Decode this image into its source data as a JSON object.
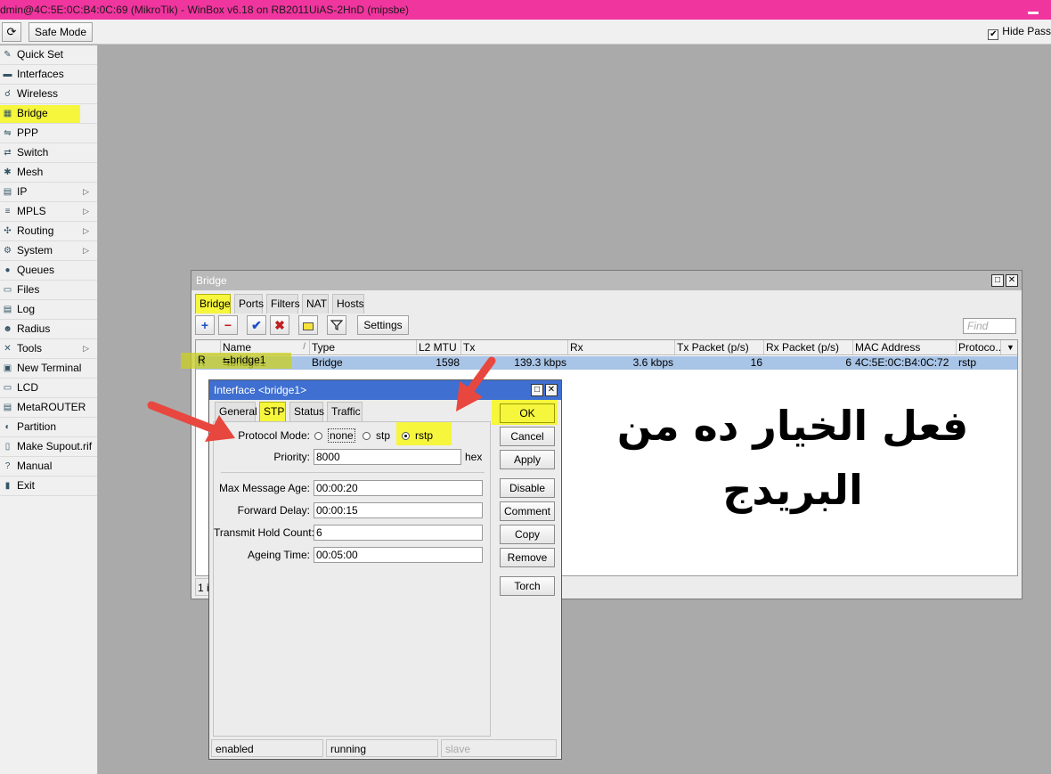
{
  "title_bar": {
    "text": "dmin@4C:5E:0C:B4:0C:69 (MikroTik) - WinBox v6.18 on RB2011UiAS-2HnD (mipsbe)"
  },
  "toolbar": {
    "refresh_icon": "refresh-icon",
    "safe_mode": "Safe Mode",
    "hide_pass": "Hide Pass",
    "hide_pass_checked": true
  },
  "sidebar": {
    "items": [
      {
        "label": "Quick Set",
        "icon": "quick-set-icon",
        "submenu": false
      },
      {
        "label": "Interfaces",
        "icon": "interfaces-icon",
        "submenu": false
      },
      {
        "label": "Wireless",
        "icon": "wireless-icon",
        "submenu": false
      },
      {
        "label": "Bridge",
        "icon": "bridge-icon",
        "submenu": false,
        "highlighted": true
      },
      {
        "label": "PPP",
        "icon": "ppp-icon",
        "submenu": false
      },
      {
        "label": "Switch",
        "icon": "switch-icon",
        "submenu": false
      },
      {
        "label": "Mesh",
        "icon": "mesh-icon",
        "submenu": false
      },
      {
        "label": "IP",
        "icon": "ip-icon",
        "submenu": true
      },
      {
        "label": "MPLS",
        "icon": "mpls-icon",
        "submenu": true
      },
      {
        "label": "Routing",
        "icon": "routing-icon",
        "submenu": true
      },
      {
        "label": "System",
        "icon": "gear-icon",
        "submenu": true
      },
      {
        "label": "Queues",
        "icon": "queues-icon",
        "submenu": false
      },
      {
        "label": "Files",
        "icon": "folder-icon",
        "submenu": false
      },
      {
        "label": "Log",
        "icon": "log-icon",
        "submenu": false
      },
      {
        "label": "Radius",
        "icon": "radius-icon",
        "submenu": false
      },
      {
        "label": "Tools",
        "icon": "tools-icon",
        "submenu": true
      },
      {
        "label": "New Terminal",
        "icon": "terminal-icon",
        "submenu": false
      },
      {
        "label": "LCD",
        "icon": "lcd-icon",
        "submenu": false
      },
      {
        "label": "MetaROUTER",
        "icon": "metarouter-icon",
        "submenu": false
      },
      {
        "label": "Partition",
        "icon": "partition-icon",
        "submenu": false
      },
      {
        "label": "Make Supout.rif",
        "icon": "supout-icon",
        "submenu": false
      },
      {
        "label": "Manual",
        "icon": "manual-icon",
        "submenu": false
      },
      {
        "label": "Exit",
        "icon": "exit-icon",
        "submenu": false
      }
    ]
  },
  "bridge_window": {
    "title": "Bridge",
    "tabs": [
      "Bridge",
      "Ports",
      "Filters",
      "NAT",
      "Hosts"
    ],
    "active_tab": "Bridge",
    "settings_label": "Settings",
    "find_placeholder": "Find",
    "columns": [
      "",
      "Name",
      "Type",
      "L2 MTU",
      "Tx",
      "Rx",
      "Tx Packet (p/s)",
      "Rx Packet (p/s)",
      "MAC Address",
      "Protoco..."
    ],
    "rows": [
      {
        "flag": "R",
        "name": "bridge1",
        "type": "Bridge",
        "l2mtu": "1598",
        "tx": "139.3 kbps",
        "rx": "3.6 kbps",
        "tx_pps": "16",
        "rx_pps": "6",
        "mac": "4C:5E:0C:B4:0C:72",
        "protocol": "rstp"
      }
    ],
    "status": "1 it"
  },
  "interface_dialog": {
    "title": "Interface <bridge1>",
    "tabs": [
      "General",
      "STP",
      "Status",
      "Traffic"
    ],
    "active_tab": "STP",
    "fields": {
      "protocol_mode_label": "Protocol Mode:",
      "protocol_options": [
        "none",
        "stp",
        "rstp"
      ],
      "protocol_selected": "rstp",
      "priority_label": "Priority:",
      "priority_value": "8000",
      "priority_unit": "hex",
      "max_message_age_label": "Max Message Age:",
      "max_message_age_value": "00:00:20",
      "forward_delay_label": "Forward Delay:",
      "forward_delay_value": "00:00:15",
      "transmit_hold_count_label": "Transmit Hold Count:",
      "transmit_hold_count_value": "6",
      "ageing_time_label": "Ageing Time:",
      "ageing_time_value": "00:05:00"
    },
    "buttons": [
      "OK",
      "Cancel",
      "Apply",
      "Disable",
      "Comment",
      "Copy",
      "Remove",
      "Torch"
    ],
    "status": [
      "enabled",
      "running",
      "slave"
    ]
  },
  "annotation": {
    "line1": "فعل الخيار ده من",
    "line2": "البريدج",
    "arrow_color": "#e8473f",
    "highlight_color": "#f6f63d"
  }
}
